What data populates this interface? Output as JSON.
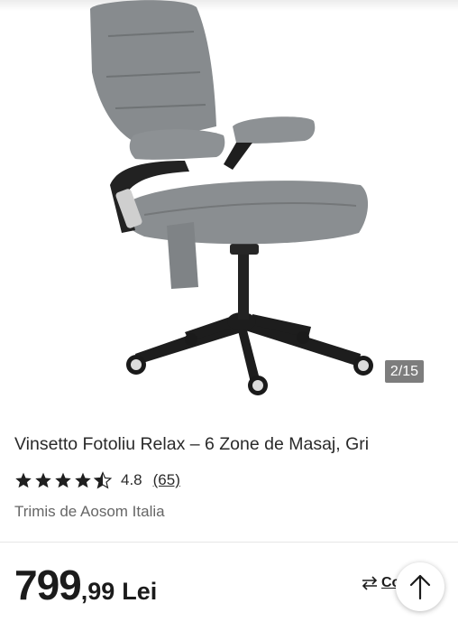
{
  "gallery": {
    "image_alt": "product-photo-office-chair",
    "counter": "2/15"
  },
  "product": {
    "title": "Vinsetto Fotoliu Relax – 6 Zone de Masaj, Gri",
    "rating_value": "4.8",
    "rating_stars": 4.5,
    "review_count": "(65)",
    "seller": "Trimis de Aosom Italia"
  },
  "price": {
    "integer": "799",
    "decimal": ",99",
    "currency": "Lei"
  },
  "actions": {
    "compare_label": "Co",
    "compare_icon": "compare-arrows-icon",
    "scroll_top_icon": "arrow-up-icon"
  },
  "colors": {
    "fabric": "#85898c",
    "frame": "#1c1c1c",
    "counter_bg": "#7d7d7d"
  }
}
